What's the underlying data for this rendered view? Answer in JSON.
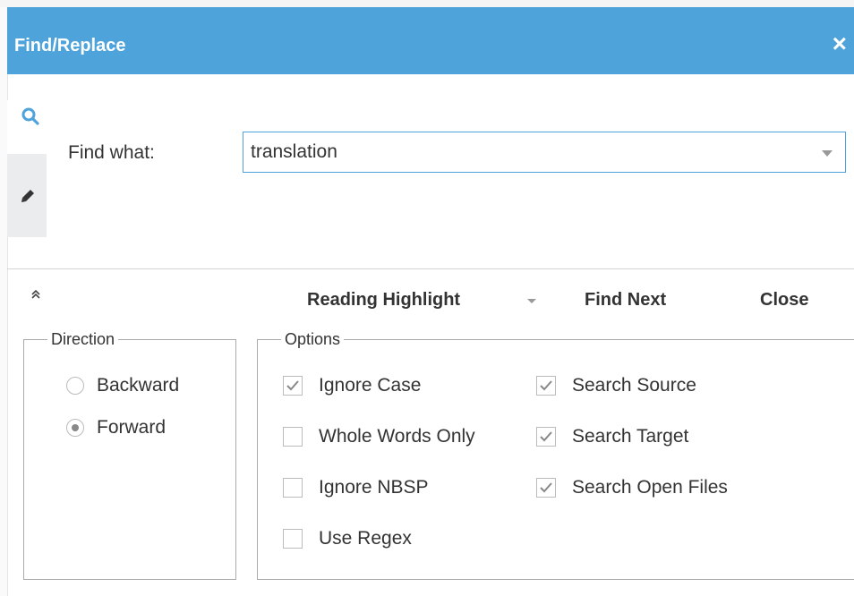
{
  "dialog": {
    "title": "Find/Replace",
    "close_glyph": "×"
  },
  "tabs": [
    {
      "icon": "search-icon",
      "active": true
    },
    {
      "icon": "pencil-icon",
      "active": false
    }
  ],
  "find": {
    "label": "Find what:",
    "value": "translation"
  },
  "toolbar": {
    "collapse_glyph": "«",
    "reading_highlight": "Reading Highlight",
    "find_next": "Find Next",
    "close": "Close"
  },
  "direction": {
    "legend": "Direction",
    "backward": "Backward",
    "forward": "Forward",
    "selected": "Forward"
  },
  "options": {
    "legend": "Options",
    "ignore_case": {
      "label": "Ignore Case",
      "checked": true
    },
    "whole_words": {
      "label": "Whole Words Only",
      "checked": false
    },
    "ignore_nbsp": {
      "label": "Ignore NBSP",
      "checked": false
    },
    "use_regex": {
      "label": "Use Regex",
      "checked": false
    },
    "search_source": {
      "label": "Search Source",
      "checked": true
    },
    "search_target": {
      "label": "Search Target",
      "checked": true
    },
    "search_open_files": {
      "label": "Search Open Files",
      "checked": true
    }
  },
  "colors": {
    "accent": "#4fa3db",
    "tab_inactive": "#ebecee"
  }
}
